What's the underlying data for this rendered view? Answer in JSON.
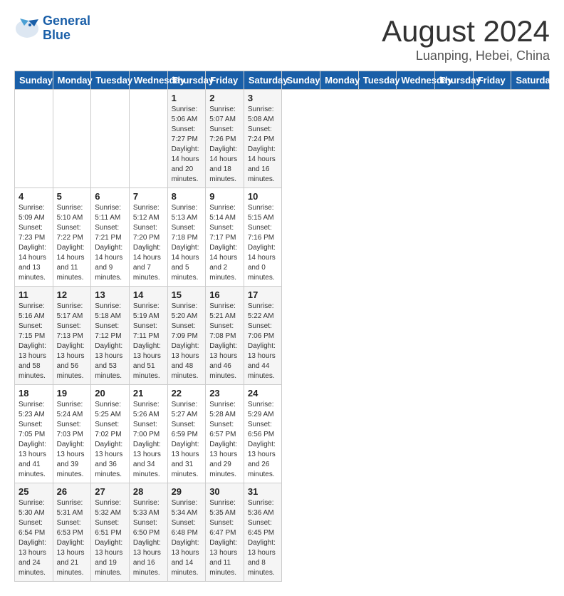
{
  "header": {
    "logo_line1": "General",
    "logo_line2": "Blue",
    "month_year": "August 2024",
    "location": "Luanping, Hebei, China"
  },
  "days_of_week": [
    "Sunday",
    "Monday",
    "Tuesday",
    "Wednesday",
    "Thursday",
    "Friday",
    "Saturday"
  ],
  "weeks": [
    [
      {
        "day": "",
        "text": ""
      },
      {
        "day": "",
        "text": ""
      },
      {
        "day": "",
        "text": ""
      },
      {
        "day": "",
        "text": ""
      },
      {
        "day": "1",
        "text": "Sunrise: 5:06 AM\nSunset: 7:27 PM\nDaylight: 14 hours\nand 20 minutes."
      },
      {
        "day": "2",
        "text": "Sunrise: 5:07 AM\nSunset: 7:26 PM\nDaylight: 14 hours\nand 18 minutes."
      },
      {
        "day": "3",
        "text": "Sunrise: 5:08 AM\nSunset: 7:24 PM\nDaylight: 14 hours\nand 16 minutes."
      }
    ],
    [
      {
        "day": "4",
        "text": "Sunrise: 5:09 AM\nSunset: 7:23 PM\nDaylight: 14 hours\nand 13 minutes."
      },
      {
        "day": "5",
        "text": "Sunrise: 5:10 AM\nSunset: 7:22 PM\nDaylight: 14 hours\nand 11 minutes."
      },
      {
        "day": "6",
        "text": "Sunrise: 5:11 AM\nSunset: 7:21 PM\nDaylight: 14 hours\nand 9 minutes."
      },
      {
        "day": "7",
        "text": "Sunrise: 5:12 AM\nSunset: 7:20 PM\nDaylight: 14 hours\nand 7 minutes."
      },
      {
        "day": "8",
        "text": "Sunrise: 5:13 AM\nSunset: 7:18 PM\nDaylight: 14 hours\nand 5 minutes."
      },
      {
        "day": "9",
        "text": "Sunrise: 5:14 AM\nSunset: 7:17 PM\nDaylight: 14 hours\nand 2 minutes."
      },
      {
        "day": "10",
        "text": "Sunrise: 5:15 AM\nSunset: 7:16 PM\nDaylight: 14 hours\nand 0 minutes."
      }
    ],
    [
      {
        "day": "11",
        "text": "Sunrise: 5:16 AM\nSunset: 7:15 PM\nDaylight: 13 hours\nand 58 minutes."
      },
      {
        "day": "12",
        "text": "Sunrise: 5:17 AM\nSunset: 7:13 PM\nDaylight: 13 hours\nand 56 minutes."
      },
      {
        "day": "13",
        "text": "Sunrise: 5:18 AM\nSunset: 7:12 PM\nDaylight: 13 hours\nand 53 minutes."
      },
      {
        "day": "14",
        "text": "Sunrise: 5:19 AM\nSunset: 7:11 PM\nDaylight: 13 hours\nand 51 minutes."
      },
      {
        "day": "15",
        "text": "Sunrise: 5:20 AM\nSunset: 7:09 PM\nDaylight: 13 hours\nand 48 minutes."
      },
      {
        "day": "16",
        "text": "Sunrise: 5:21 AM\nSunset: 7:08 PM\nDaylight: 13 hours\nand 46 minutes."
      },
      {
        "day": "17",
        "text": "Sunrise: 5:22 AM\nSunset: 7:06 PM\nDaylight: 13 hours\nand 44 minutes."
      }
    ],
    [
      {
        "day": "18",
        "text": "Sunrise: 5:23 AM\nSunset: 7:05 PM\nDaylight: 13 hours\nand 41 minutes."
      },
      {
        "day": "19",
        "text": "Sunrise: 5:24 AM\nSunset: 7:03 PM\nDaylight: 13 hours\nand 39 minutes."
      },
      {
        "day": "20",
        "text": "Sunrise: 5:25 AM\nSunset: 7:02 PM\nDaylight: 13 hours\nand 36 minutes."
      },
      {
        "day": "21",
        "text": "Sunrise: 5:26 AM\nSunset: 7:00 PM\nDaylight: 13 hours\nand 34 minutes."
      },
      {
        "day": "22",
        "text": "Sunrise: 5:27 AM\nSunset: 6:59 PM\nDaylight: 13 hours\nand 31 minutes."
      },
      {
        "day": "23",
        "text": "Sunrise: 5:28 AM\nSunset: 6:57 PM\nDaylight: 13 hours\nand 29 minutes."
      },
      {
        "day": "24",
        "text": "Sunrise: 5:29 AM\nSunset: 6:56 PM\nDaylight: 13 hours\nand 26 minutes."
      }
    ],
    [
      {
        "day": "25",
        "text": "Sunrise: 5:30 AM\nSunset: 6:54 PM\nDaylight: 13 hours\nand 24 minutes."
      },
      {
        "day": "26",
        "text": "Sunrise: 5:31 AM\nSunset: 6:53 PM\nDaylight: 13 hours\nand 21 minutes."
      },
      {
        "day": "27",
        "text": "Sunrise: 5:32 AM\nSunset: 6:51 PM\nDaylight: 13 hours\nand 19 minutes."
      },
      {
        "day": "28",
        "text": "Sunrise: 5:33 AM\nSunset: 6:50 PM\nDaylight: 13 hours\nand 16 minutes."
      },
      {
        "day": "29",
        "text": "Sunrise: 5:34 AM\nSunset: 6:48 PM\nDaylight: 13 hours\nand 14 minutes."
      },
      {
        "day": "30",
        "text": "Sunrise: 5:35 AM\nSunset: 6:47 PM\nDaylight: 13 hours\nand 11 minutes."
      },
      {
        "day": "31",
        "text": "Sunrise: 5:36 AM\nSunset: 6:45 PM\nDaylight: 13 hours\nand 8 minutes."
      }
    ]
  ]
}
